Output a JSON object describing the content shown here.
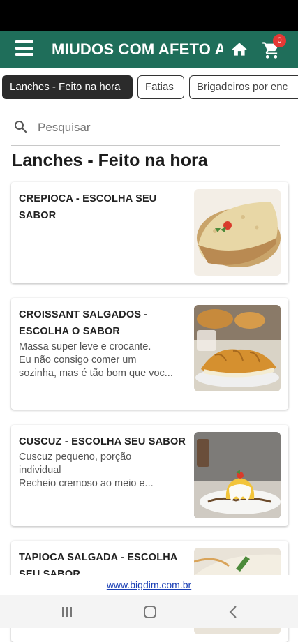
{
  "header": {
    "title": "MIUDOS COM AFETO A",
    "cart_count": "0",
    "menu_icon": "hamburger-menu-icon",
    "home_icon": "home-icon",
    "cart_icon": "shopping-cart-icon",
    "brand_color": "#1f6e5a"
  },
  "categories": [
    {
      "label": "Lanches - Feito na hora",
      "active": true
    },
    {
      "label": "Fatias",
      "active": false
    },
    {
      "label": "Brigadeiros por enc",
      "active": false
    }
  ],
  "search": {
    "placeholder": "Pesquisar",
    "icon": "search-icon"
  },
  "section": {
    "title": "Lanches - Feito na hora"
  },
  "products": [
    {
      "title": [
        "CREPIOCA - ESCOLHA SEU",
        "SABOR"
      ],
      "description": [],
      "image": "crepioca-image"
    },
    {
      "title": [
        "CROISSANT SALGADOS -",
        "ESCOLHA O SABOR"
      ],
      "description": [
        "Massa super leve e crocante.",
        "Eu não consigo comer um",
        "sozinha, mas é tão bom que voc..."
      ],
      "image": "croissant-image"
    },
    {
      "title": [
        "CUSCUZ - ESCOLHA SEU SABOR"
      ],
      "description": [
        "Cuscuz pequeno, porção",
        "individual",
        "Recheio cremoso ao meio e..."
      ],
      "image": "cuscuz-image"
    },
    {
      "title": [
        "TAPIOCA SALGADA - ESCOLHA",
        "SEU SABOR"
      ],
      "description": [],
      "image": "tapioca-image"
    }
  ],
  "footer": {
    "link": "www.bigdim.com.br",
    "link_color": "#1a3fb5"
  },
  "system_nav": {
    "recents_icon": "recents-icon",
    "home_icon": "android-home-icon",
    "back_icon": "back-icon"
  }
}
